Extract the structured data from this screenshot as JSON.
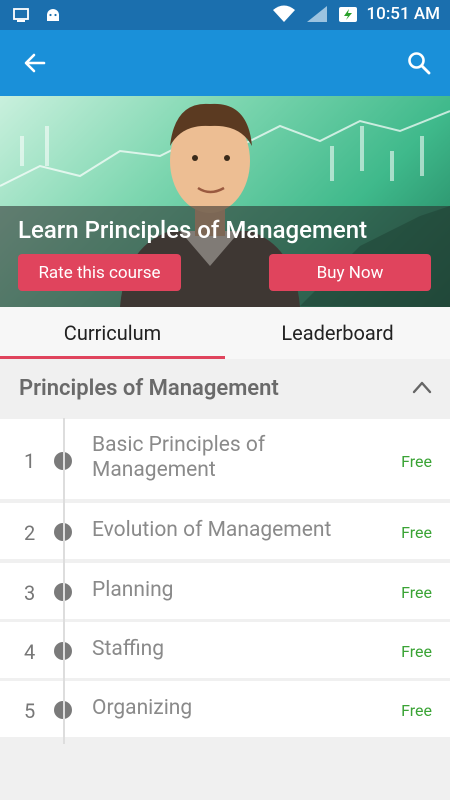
{
  "status_bar": {
    "time": "10:51 AM",
    "icons": [
      "screen-cast-icon",
      "android-icon",
      "wifi-icon",
      "signal-icon",
      "battery-charging-icon"
    ]
  },
  "app_bar": {
    "back_icon": "arrow-back-icon",
    "search_icon": "search-icon",
    "color": "#1a90d9"
  },
  "hero": {
    "title": "Learn Principles of Management",
    "rate_label": "Rate this course",
    "buy_label": "Buy Now",
    "accent": "#e0445d"
  },
  "tabs": [
    {
      "label": "Curriculum",
      "active": true
    },
    {
      "label": "Leaderboard",
      "active": false
    }
  ],
  "section": {
    "title": "Principles of Management",
    "collapse_icon": "chevron-up-icon"
  },
  "lessons": [
    {
      "num": "1",
      "title_line1": "Basic Principles of",
      "title_line2": "Management",
      "price": "Free"
    },
    {
      "num": "2",
      "title_line1": "Evolution of Management",
      "title_line2": "",
      "price": "Free"
    },
    {
      "num": "3",
      "title_line1": "Planning",
      "title_line2": "",
      "price": "Free"
    },
    {
      "num": "4",
      "title_line1": "Staffing",
      "title_line2": "",
      "price": "Free"
    },
    {
      "num": "5",
      "title_line1": "Organizing",
      "title_line2": "",
      "price": "Free"
    }
  ]
}
